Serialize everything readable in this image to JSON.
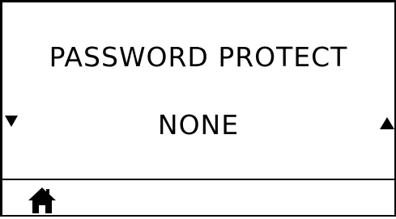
{
  "screen": {
    "title": "PASSWORD PROTECT",
    "value": "NONE"
  },
  "icons": {
    "previous": "triangle-down-icon",
    "next": "triangle-up-icon",
    "home": "home-icon"
  },
  "colors": {
    "foreground": "#000000",
    "background": "#ffffff"
  }
}
